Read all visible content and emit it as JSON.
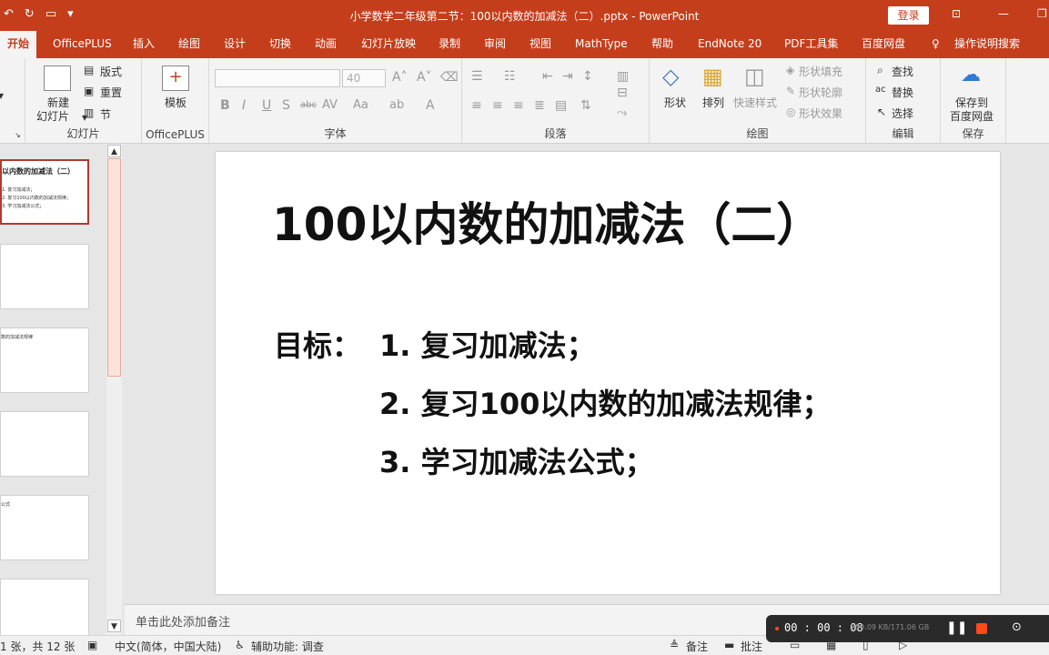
{
  "titlebar": {
    "title": "小学数学二年级第二节：100以内数的加减法（二）.pptx  -  PowerPoint",
    "login": "登录"
  },
  "tabs": [
    "开始",
    "OfficePLUS",
    "插入",
    "绘图",
    "设计",
    "切换",
    "动画",
    "幻灯片放映",
    "录制",
    "审阅",
    "视图",
    "MathType",
    "帮助",
    "EndNote 20",
    "PDF工具集",
    "百度网盘",
    "操作说明搜索"
  ],
  "ribbon": {
    "slides_group": {
      "new_slide_line1": "新建",
      "new_slide_line2": "幻灯片",
      "layout": "版式",
      "reset": "重置",
      "section": "节",
      "label": "幻灯片"
    },
    "officeplus_group": {
      "template": "模板",
      "label": "OfficePLUS"
    },
    "font_group": {
      "size": "40",
      "label": "字体"
    },
    "paragraph_group": {
      "label": "段落"
    },
    "drawing_group": {
      "shape": "形状",
      "arrange": "排列",
      "quick_style": "快速样式",
      "fill": "形状填充",
      "outline": "形状轮廓",
      "effect": "形状效果",
      "label": "绘图"
    },
    "edit_group": {
      "find": "查找",
      "replace": "替换",
      "select": "选择",
      "label": "编辑"
    },
    "save_group": {
      "save_line1": "保存到",
      "save_line2": "百度网盘",
      "label": "保存"
    }
  },
  "thumbnails": [
    {
      "title": "以内数的加减法（二）",
      "lines": [
        "1. 复习加减法；",
        "2. 复习100以内数的加减法规律；",
        "3. 学习加减法公式；"
      ]
    },
    {
      "title": "",
      "lines": []
    },
    {
      "title": "",
      "lines": [
        "数的加减法规律"
      ]
    },
    {
      "title": "",
      "lines": []
    },
    {
      "title": "",
      "lines": [
        "公式"
      ]
    },
    {
      "title": "",
      "lines": []
    }
  ],
  "slide": {
    "title": "100以内数的加减法（二）",
    "goal_label": "目标：",
    "goals": [
      "1. 复习加减法；",
      "2. 复习100以内数的加减法规律；",
      "3. 学习加减法公式；"
    ]
  },
  "notes": {
    "placeholder": "单击此处添加备注"
  },
  "status": {
    "slide_count": "1 张，共 12 张",
    "language": "中文(简体，中国大陆)",
    "accessibility": "辅助功能: 调查",
    "notes_btn": "备注",
    "comments_btn": "批注"
  },
  "recorder": {
    "time": "00 : 00 : 08",
    "rate": "759.09 KB/171.06 GB"
  },
  "colors": {
    "accent": "#c43e1c",
    "recorder_stop": "#ff4a1a"
  }
}
